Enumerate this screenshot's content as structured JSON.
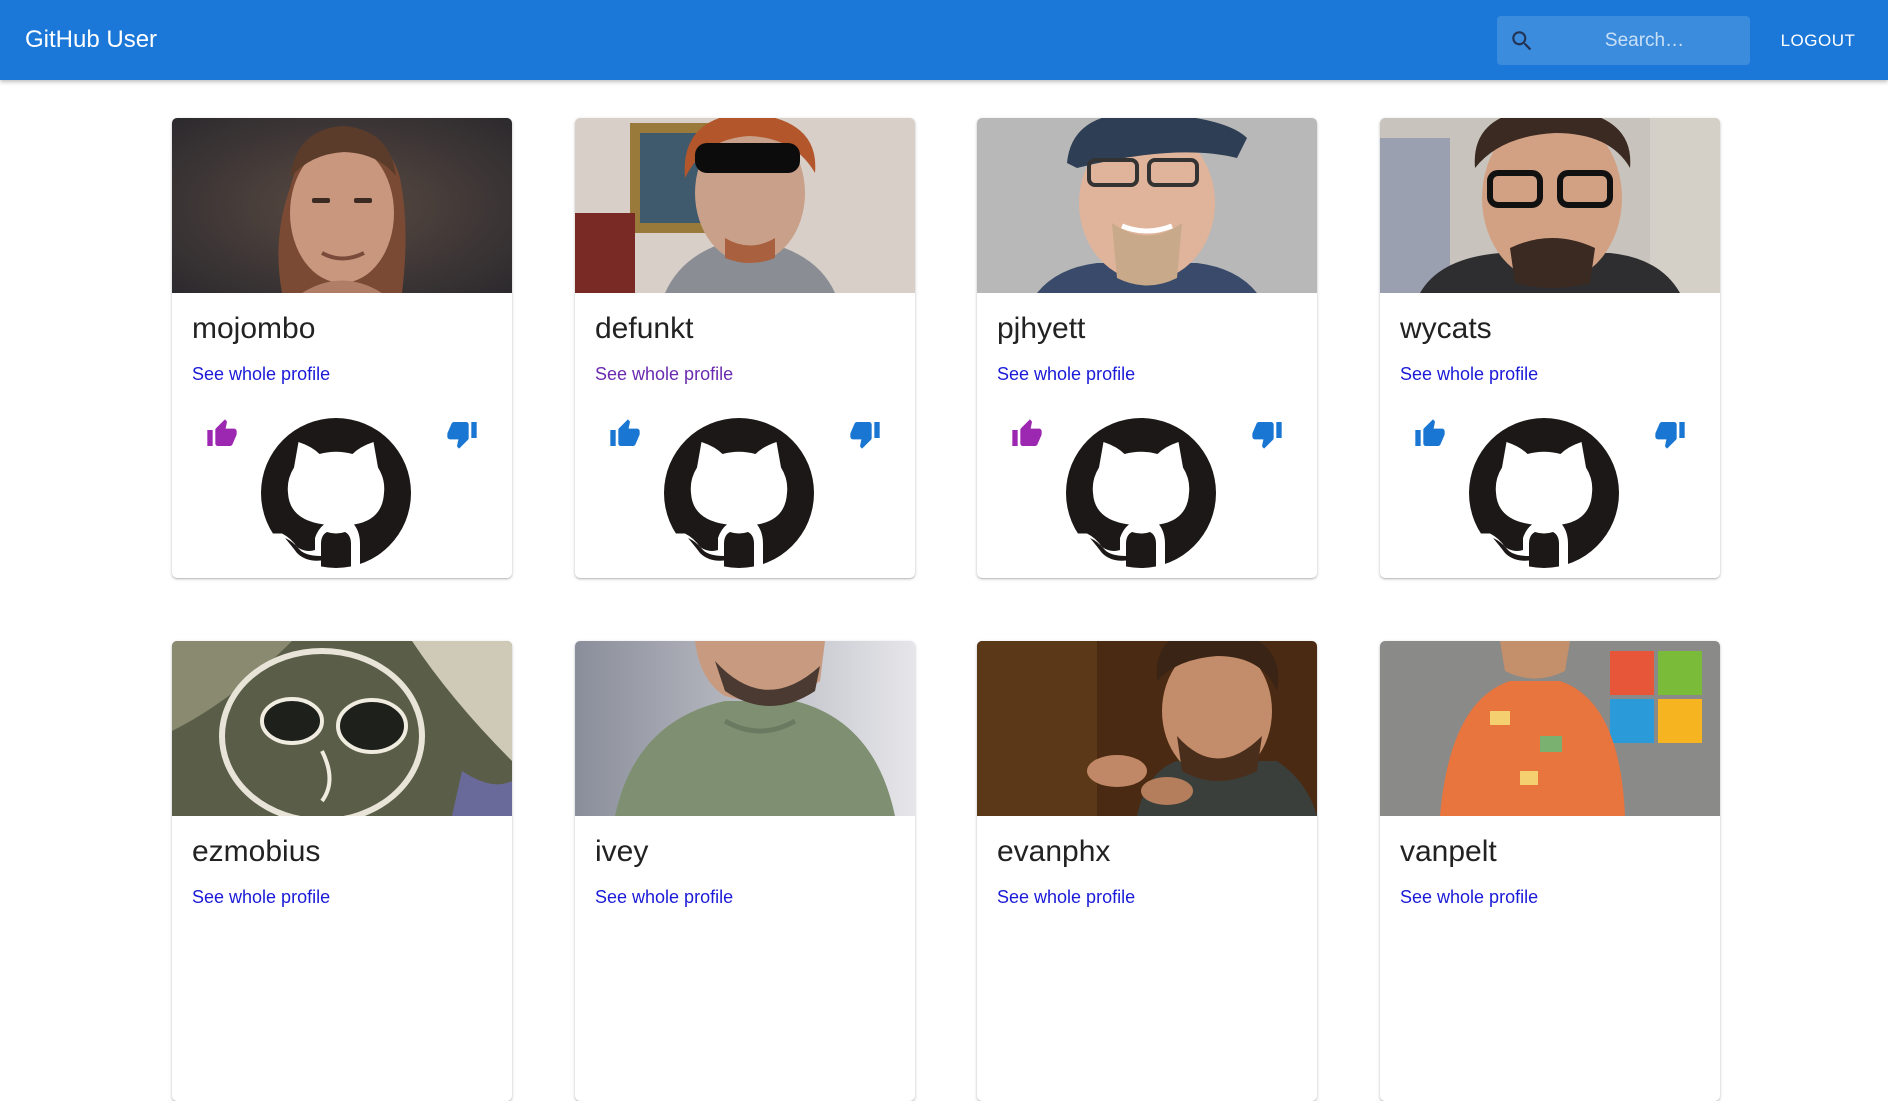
{
  "app": {
    "title": "GitHub User"
  },
  "search": {
    "placeholder": "Search…"
  },
  "header": {
    "logout_label": "LOGOUT"
  },
  "colors": {
    "appbar": "#1b78d8",
    "link": "#1a1ad8",
    "link_visited": "#6a2bb0",
    "liked": "#9c27b0",
    "neutral_thumb": "#1976d2",
    "octocat": "#1b1817"
  },
  "cards": [
    {
      "login": "mojombo",
      "link_label": "See whole profile",
      "liked": true,
      "visited": false
    },
    {
      "login": "defunkt",
      "link_label": "See whole profile",
      "liked": false,
      "visited": true
    },
    {
      "login": "pjhyett",
      "link_label": "See whole profile",
      "liked": true,
      "visited": false
    },
    {
      "login": "wycats",
      "link_label": "See whole profile",
      "liked": false,
      "visited": false
    },
    {
      "login": "ezmobius",
      "link_label": "See whole profile",
      "liked": false,
      "visited": false
    },
    {
      "login": "ivey",
      "link_label": "See whole profile",
      "liked": false,
      "visited": false
    },
    {
      "login": "evanphx",
      "link_label": "See whole profile",
      "liked": false,
      "visited": false
    },
    {
      "login": "vanpelt",
      "link_label": "See whole profile",
      "liked": false,
      "visited": false
    }
  ]
}
